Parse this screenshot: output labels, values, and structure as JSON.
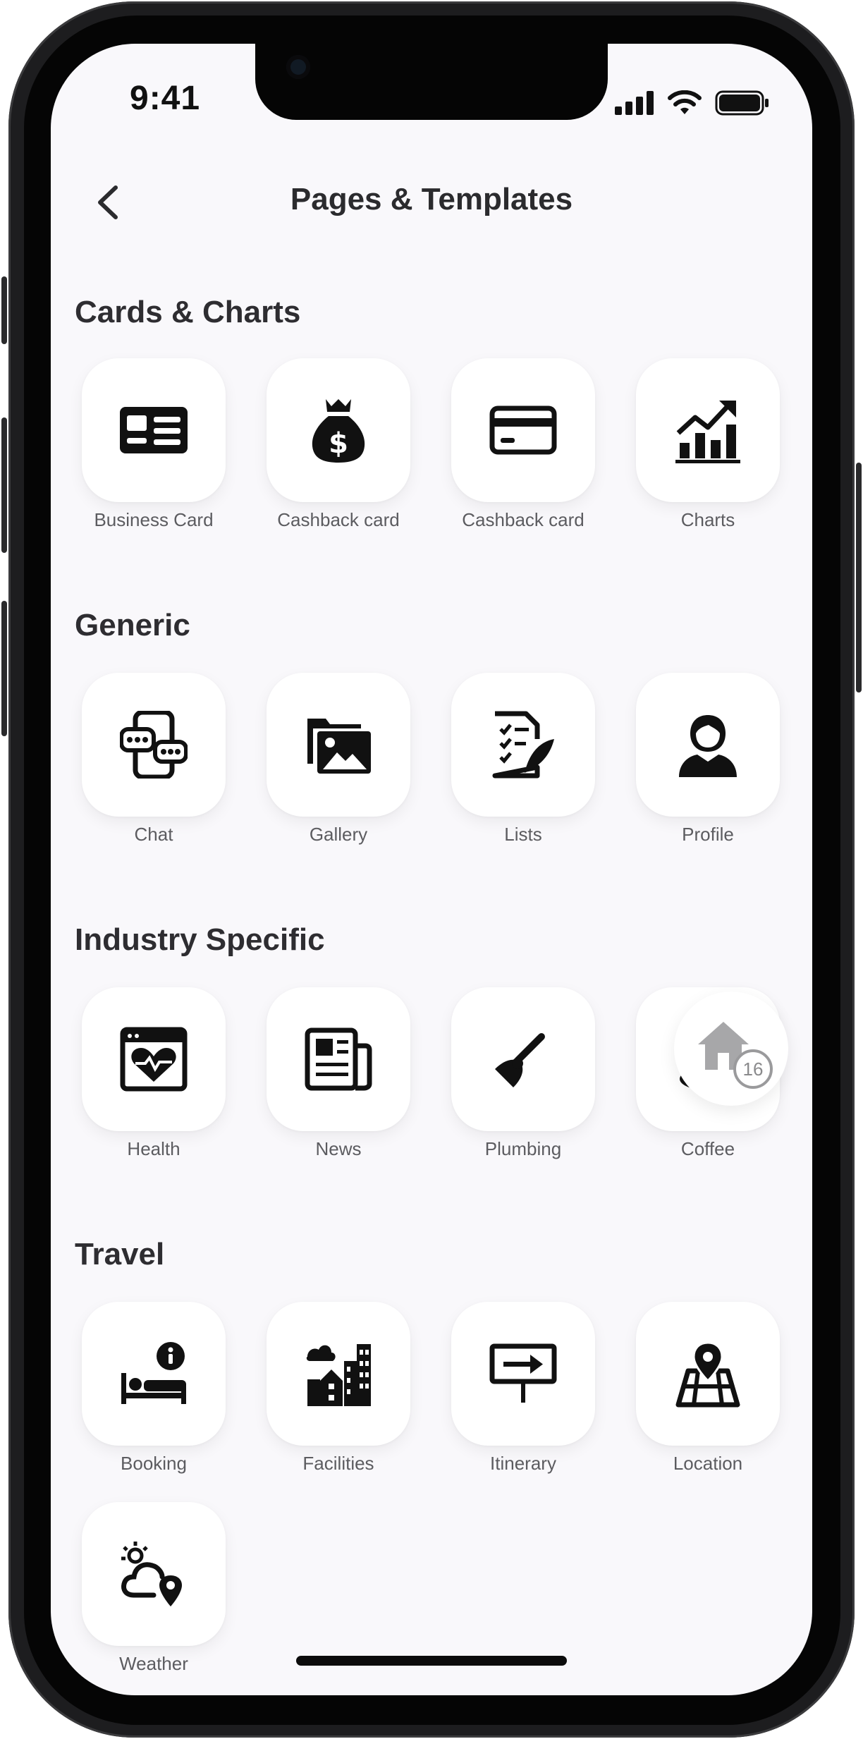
{
  "status_bar": {
    "time": "9:41"
  },
  "header": {
    "title": "Pages & Templates"
  },
  "sections": [
    {
      "title": "Cards & Charts",
      "items": [
        {
          "label": "Business Card",
          "icon": "business-card-icon"
        },
        {
          "label": "Cashback card",
          "icon": "money-bag-icon"
        },
        {
          "label": "Cashback card",
          "icon": "credit-card-icon"
        },
        {
          "label": "Charts",
          "icon": "bar-chart-icon"
        }
      ]
    },
    {
      "title": "Generic",
      "items": [
        {
          "label": "Chat",
          "icon": "chat-icon"
        },
        {
          "label": "Gallery",
          "icon": "gallery-icon"
        },
        {
          "label": "Lists",
          "icon": "checklist-icon"
        },
        {
          "label": "Profile",
          "icon": "profile-icon"
        }
      ]
    },
    {
      "title": "Industry Specific",
      "items": [
        {
          "label": "Health",
          "icon": "health-icon"
        },
        {
          "label": "News",
          "icon": "newspaper-icon"
        },
        {
          "label": "Plumbing",
          "icon": "plunger-icon"
        },
        {
          "label": "Coffee",
          "icon": "coffee-cup-icon"
        }
      ]
    },
    {
      "title": "Travel",
      "items": [
        {
          "label": "Booking",
          "icon": "bed-info-icon"
        },
        {
          "label": "Facilities",
          "icon": "buildings-icon"
        },
        {
          "label": "Itinerary",
          "icon": "signboard-icon"
        },
        {
          "label": "Location",
          "icon": "map-pin-icon"
        },
        {
          "label": "Weather",
          "icon": "weather-location-icon"
        }
      ]
    }
  ],
  "fab": {
    "badge": "16",
    "icon": "home-icon"
  },
  "colors": {
    "background": "#f9f8fb",
    "tile": "#ffffff",
    "text": "#2e2d31",
    "label": "#5c5c60"
  }
}
